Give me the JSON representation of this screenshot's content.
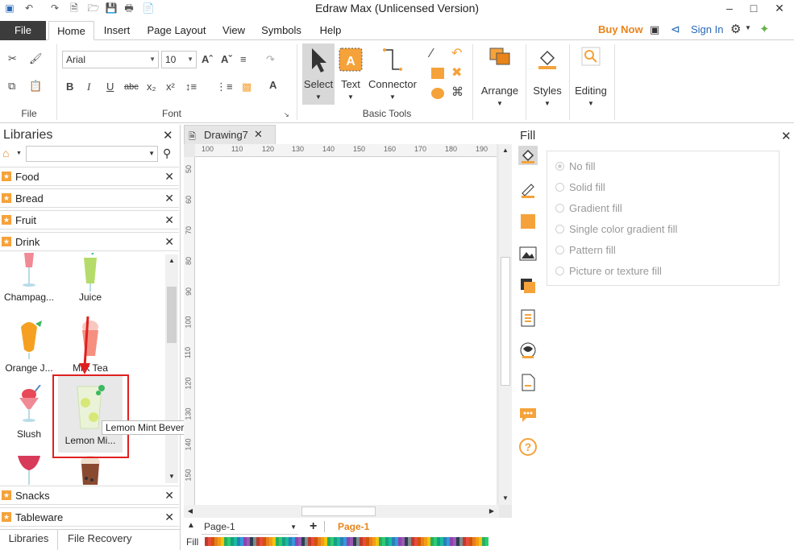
{
  "window": {
    "title": "Edraw Max (Unlicensed Version)"
  },
  "tabs": [
    "File",
    "Home",
    "Insert",
    "Page Layout",
    "View",
    "Symbols",
    "Help"
  ],
  "header_links": {
    "buy_now": "Buy Now",
    "sign_in": "Sign In"
  },
  "ribbon": {
    "font_name": "Arial",
    "font_size": "10",
    "groups": {
      "file": "File",
      "font": "Font",
      "basic_tools": "Basic Tools"
    },
    "tools": {
      "select": "Select",
      "text": "Text",
      "connector": "Connector"
    },
    "big_buttons": {
      "arrange": "Arrange",
      "styles": "Styles",
      "editing": "Editing"
    }
  },
  "libraries": {
    "title": "Libraries",
    "search_value": "",
    "categories_top": [
      "Food",
      "Bread",
      "Fruit",
      "Drink"
    ],
    "categories_bottom": [
      "Snacks",
      "Tableware"
    ],
    "shapes": [
      {
        "label": "Champag..."
      },
      {
        "label": "Juice"
      },
      {
        "label": "Orange J..."
      },
      {
        "label": "Milk Tea"
      },
      {
        "label": "Slush"
      },
      {
        "label": "Lemon Mi..."
      }
    ],
    "tooltip": "Lemon Mint Beverage",
    "bottom_tabs": [
      "Libraries",
      "File Recovery"
    ]
  },
  "document": {
    "tab_name": "Drawing7",
    "ruler_top": [
      "100",
      "110",
      "120",
      "130",
      "140",
      "150",
      "160",
      "170",
      "180",
      "190"
    ],
    "ruler_left": [
      "50",
      "60",
      "70",
      "80",
      "90",
      "100",
      "110",
      "120",
      "130",
      "140",
      "150"
    ],
    "page_selector": "Page-1",
    "active_page": "Page-1",
    "fill_label": "Fill"
  },
  "fill_panel": {
    "title": "Fill",
    "options": [
      "No fill",
      "Solid fill",
      "Gradient fill",
      "Single color gradient fill",
      "Pattern fill",
      "Picture or texture fill"
    ]
  },
  "colors": {
    "accent_orange": "#f5a23a",
    "buy_now": "#e8841a",
    "link_blue": "#2a6ab8",
    "highlight_red": "#e02020"
  }
}
